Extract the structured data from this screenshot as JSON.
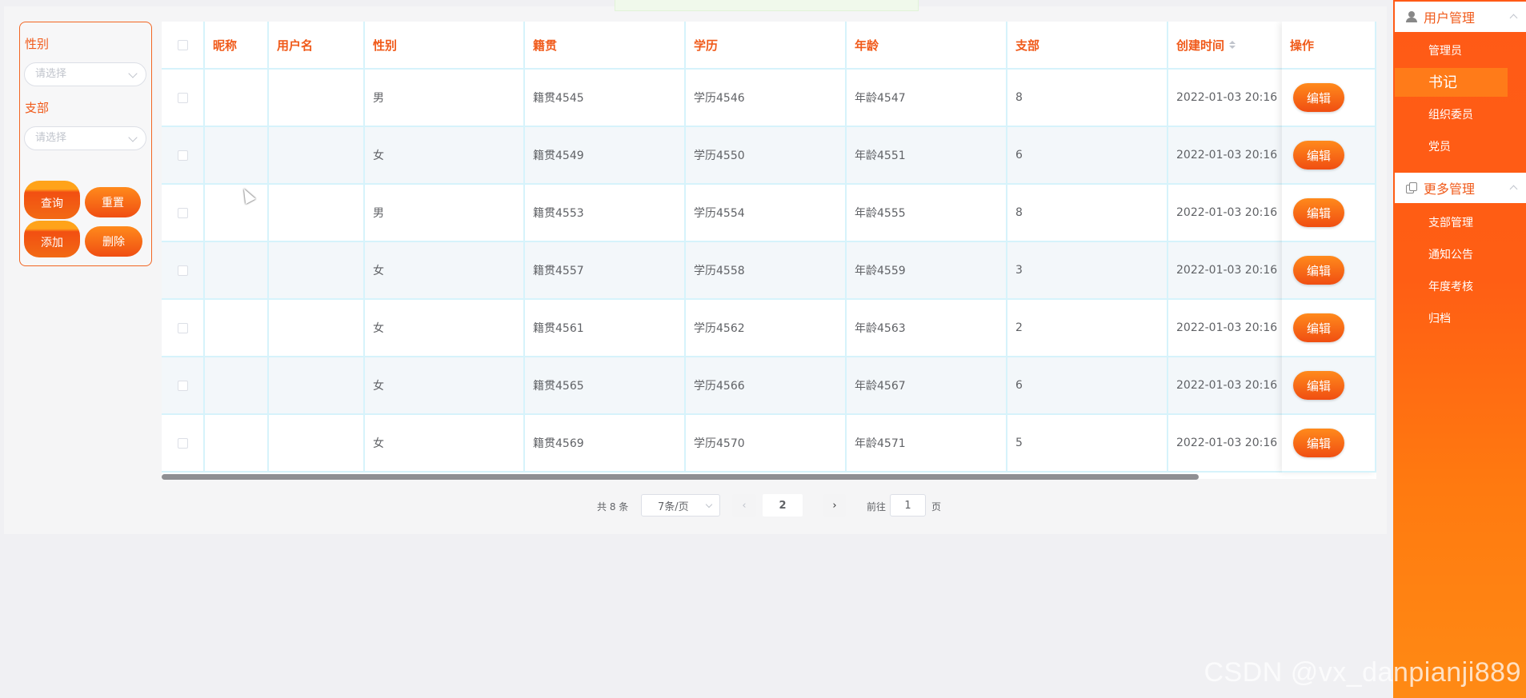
{
  "filter": {
    "gender_label": "性别",
    "gender_placeholder": "请选择",
    "branch_label": "支部",
    "branch_placeholder": "请选择",
    "query": "查询",
    "reset": "重置",
    "add": "添加",
    "delete": "删除"
  },
  "table": {
    "headers": {
      "nickname": "昵称",
      "username": "用户名",
      "gender": "性别",
      "native": "籍贯",
      "education": "学历",
      "age": "年龄",
      "branch": "支部",
      "created": "创建时间",
      "ops": "操作"
    },
    "edit_label": "编辑",
    "rows": [
      {
        "nickname": "",
        "username": "",
        "gender": "男",
        "native": "籍贯4545",
        "education": "学历4546",
        "age": "年龄4547",
        "branch": "8",
        "created": "2022-01-03 20:16"
      },
      {
        "nickname": "",
        "username": "",
        "gender": "女",
        "native": "籍贯4549",
        "education": "学历4550",
        "age": "年龄4551",
        "branch": "6",
        "created": "2022-01-03 20:16"
      },
      {
        "nickname": "",
        "username": "",
        "gender": "男",
        "native": "籍贯4553",
        "education": "学历4554",
        "age": "年龄4555",
        "branch": "8",
        "created": "2022-01-03 20:16"
      },
      {
        "nickname": "",
        "username": "",
        "gender": "女",
        "native": "籍贯4557",
        "education": "学历4558",
        "age": "年龄4559",
        "branch": "3",
        "created": "2022-01-03 20:16"
      },
      {
        "nickname": "",
        "username": "",
        "gender": "女",
        "native": "籍贯4561",
        "education": "学历4562",
        "age": "年龄4563",
        "branch": "2",
        "created": "2022-01-03 20:16"
      },
      {
        "nickname": "",
        "username": "",
        "gender": "女",
        "native": "籍贯4565",
        "education": "学历4566",
        "age": "年龄4567",
        "branch": "6",
        "created": "2022-01-03 20:16"
      },
      {
        "nickname": "",
        "username": "",
        "gender": "女",
        "native": "籍贯4569",
        "education": "学历4570",
        "age": "年龄4571",
        "branch": "5",
        "created": "2022-01-03 20:16"
      }
    ]
  },
  "pagination": {
    "total": "共 8 条",
    "page_size": "7条/页",
    "current": "2",
    "goto_label": "前往",
    "goto_value": "1",
    "page_suffix": "页"
  },
  "sidebar": {
    "group1": "用户管理",
    "group1_items": [
      "管理员",
      "书记",
      "组织委员",
      "党员"
    ],
    "active_index": 1,
    "group2": "更多管理",
    "group2_items": [
      "支部管理",
      "通知公告",
      "年度考核",
      "归档"
    ]
  },
  "watermark": "CSDN @vx_danpianji889"
}
